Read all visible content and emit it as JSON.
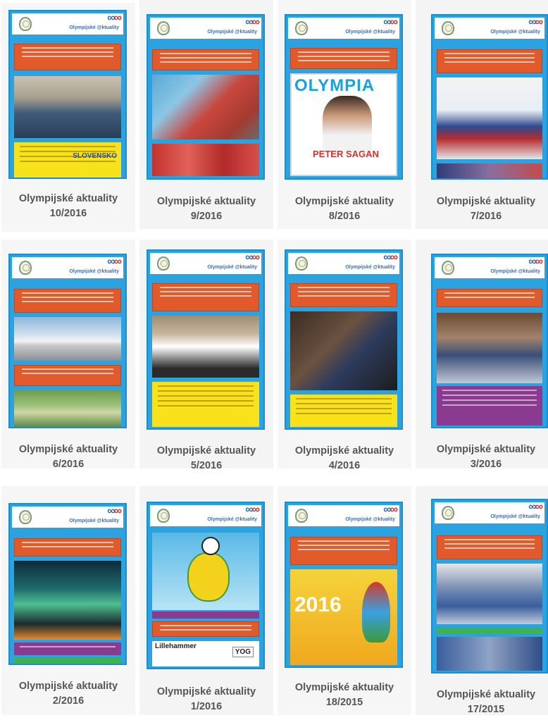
{
  "thumbnail_header": {
    "brand": "Olympijské @ktuality"
  },
  "cards": [
    {
      "title": "Olympijské aktuality",
      "issue": "10/2016"
    },
    {
      "title": "Olympijské aktuality",
      "issue": "9/2016"
    },
    {
      "title": "Olympijské aktuality",
      "issue": "8/2016"
    },
    {
      "title": "Olympijské aktuality",
      "issue": "7/2016"
    },
    {
      "title": "Olympijské aktuality",
      "issue": "6/2016"
    },
    {
      "title": "Olympijské aktuality",
      "issue": "5/2016"
    },
    {
      "title": "Olympijské aktuality",
      "issue": "4/2016"
    },
    {
      "title": "Olympijské aktuality",
      "issue": "3/2016"
    },
    {
      "title": "Olympijské aktuality",
      "issue": "2/2016"
    },
    {
      "title": "Olympijské aktuality",
      "issue": "1/2016"
    },
    {
      "title": "Olympijské aktuality",
      "issue": "18/2015"
    },
    {
      "title": "Olympijské aktuality",
      "issue": "17/2015"
    }
  ],
  "cover_texts": {
    "c10_badge": "SLOVENSKO",
    "c8_mag": "OLYMPIA",
    "c8_name": "PETER SAGAN",
    "c1_tag": "Lillehammer",
    "c1_yog": "YOG",
    "c18_year": "2016"
  },
  "colors": {
    "accent_blue": "#2aa3e0",
    "banner_red": "#e35a2a",
    "yellow": "#f7e21b",
    "caption": "#555555"
  }
}
